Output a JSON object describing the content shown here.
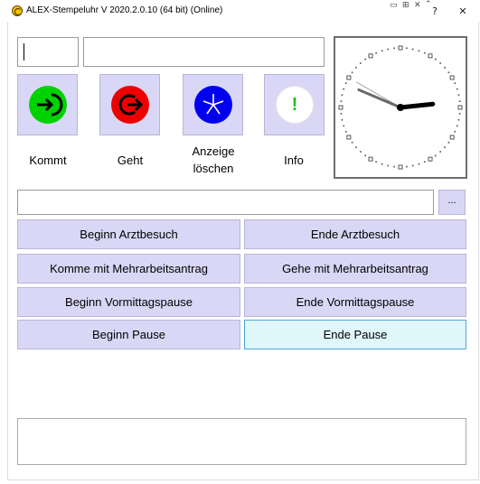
{
  "window": {
    "title": "ALEX-Stempeluhr V 2020.2.0.10 (64 bit) (Online)",
    "help_label": "?",
    "close_label": "✕"
  },
  "badge_input": {
    "value": ""
  },
  "name_input": {
    "value": ""
  },
  "tiles": [
    {
      "label": "Kommt",
      "color": "#00d100",
      "icon": "enter-icon"
    },
    {
      "label": "Geht",
      "color": "#ee0000",
      "icon": "exit-icon"
    },
    {
      "label_lines": [
        "Anzeige",
        "löschen"
      ],
      "color": "#0000ee",
      "icon": "asterisk-icon"
    },
    {
      "label": "Info",
      "color": "#ffffff",
      "icon_text": "!",
      "icon_color": "#22bb22",
      "icon": "exclamation-icon"
    }
  ],
  "clock": {
    "hours": 2,
    "minutes": 48,
    "seconds": 50
  },
  "selection_input": {
    "value": ""
  },
  "browse_button": {
    "label": "..."
  },
  "actions": [
    {
      "label": "Beginn Arztbesuch",
      "active": false
    },
    {
      "label": "Ende Arztbesuch",
      "active": false
    },
    {
      "label": "Komme mit Mehrarbeitsantrag",
      "active": false
    },
    {
      "label": "Gehe mit Mehrarbeitsantrag",
      "active": false
    },
    {
      "label": "Beginn Vormittagspause",
      "active": false
    },
    {
      "label": "Ende Vormittagspause",
      "active": false
    },
    {
      "label": "Beginn Pause",
      "active": false
    },
    {
      "label": "Ende Pause",
      "active": true
    }
  ],
  "message_box": {
    "text": ""
  },
  "colors": {
    "tile_bg": "#d9d7f5",
    "button_bg": "#d9d7f5",
    "active_bg": "#dff6fb",
    "active_border": "#4ea8d6"
  }
}
